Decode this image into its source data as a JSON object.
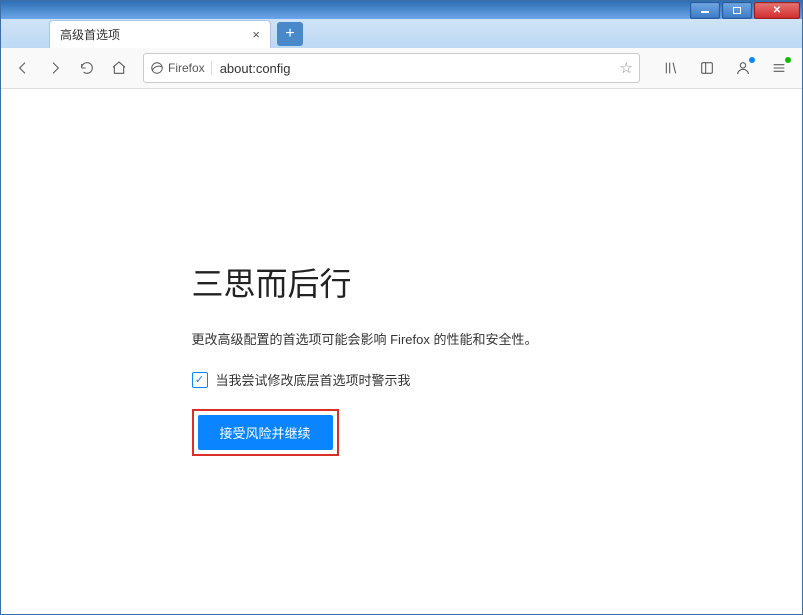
{
  "window": {
    "tab_title": "高级首选项"
  },
  "urlbar": {
    "identity_label": "Firefox",
    "url": "about:config"
  },
  "warning": {
    "title": "三思而后行",
    "description": "更改高级配置的首选项可能会影响 Firefox 的性能和安全性。",
    "checkbox_label": "当我尝试修改底层首选项时警示我",
    "accept_button": "接受风险并继续"
  }
}
